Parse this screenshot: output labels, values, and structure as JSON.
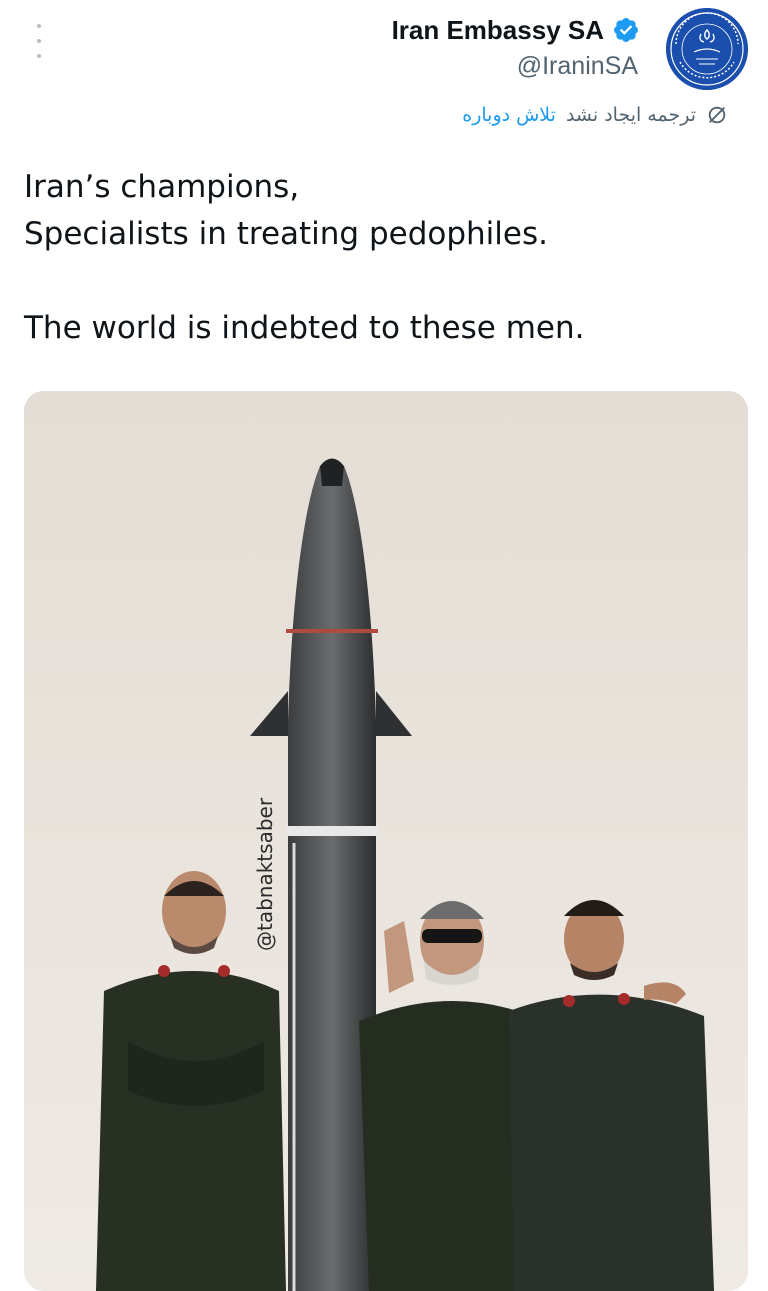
{
  "author": {
    "name": "Iran Embassy SA",
    "handle": "@IraninSA",
    "verified": true
  },
  "icons": {
    "more": "more-vertical-icon",
    "verified": "verified-badge-icon",
    "translate": "no-translate-icon",
    "avatar": "embassy-seal-logo"
  },
  "translation": {
    "status": "ترجمه ایجاد نشد",
    "retry": "تلاش دوباره"
  },
  "tweet": {
    "text": "Iran’s champions,\nSpecialists in treating pedophiles.\n\nThe world is indebted to these men."
  },
  "media": {
    "watermark": "@tabnaktsaber"
  },
  "colors": {
    "verified": "#1d9bf0",
    "link": "#1d9bf0",
    "secondary_text": "#536471",
    "avatar_bg": "#1b4fae"
  }
}
